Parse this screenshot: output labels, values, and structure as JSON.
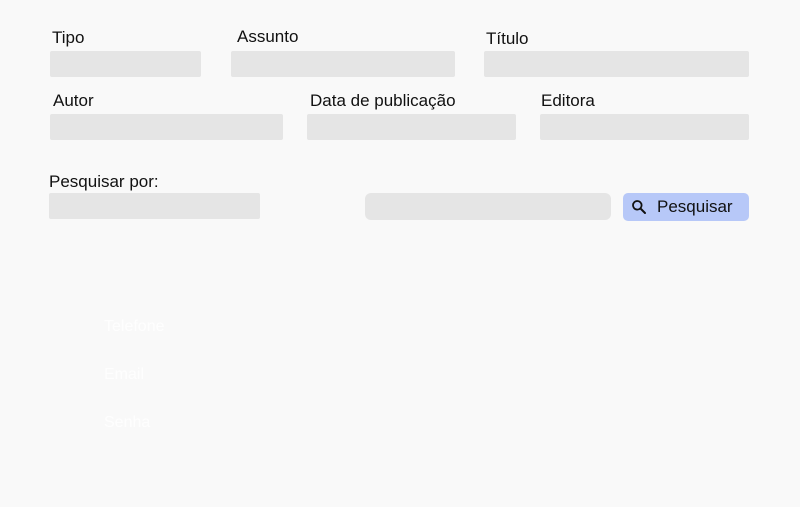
{
  "filters": {
    "tipo": {
      "label": "Tipo",
      "value": ""
    },
    "assunto": {
      "label": "Assunto",
      "value": ""
    },
    "titulo": {
      "label": "Título",
      "value": ""
    },
    "autor": {
      "label": "Autor",
      "value": ""
    },
    "data_publicacao": {
      "label": "Data de publicação",
      "value": ""
    },
    "editora": {
      "label": "Editora",
      "value": ""
    }
  },
  "search": {
    "by_label": "Pesquisar por:",
    "by_value": "",
    "query_value": "",
    "button_label": "Pesquisar",
    "button_icon": "search-icon",
    "button_color": "#b7c8f8"
  },
  "hidden_labels": [
    "Telefone",
    "Email",
    "Senha"
  ]
}
